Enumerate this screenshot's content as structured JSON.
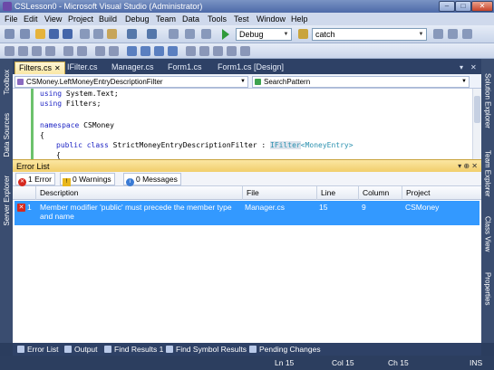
{
  "window": {
    "title": "CSLesson0 - Microsoft Visual Studio (Administrator)",
    "controls": {
      "minimize": "–",
      "maximize": "□",
      "close": "✕"
    }
  },
  "menu": [
    "File",
    "Edit",
    "View",
    "Project",
    "Build",
    "Debug",
    "Team",
    "Data",
    "Tools",
    "Test",
    "Window",
    "Help"
  ],
  "toolbar": {
    "configuration": "Debug",
    "find_value": "catch"
  },
  "left_tool_windows": [
    "Toolbox",
    "Data Sources",
    "Server Explorer"
  ],
  "right_tool_windows": [
    "Solution Explorer",
    "Team Explorer",
    "Class View",
    "Properties"
  ],
  "doc_tabs": [
    {
      "label": "Filters.cs",
      "active": true,
      "closable": true
    },
    {
      "label": "IFilter.cs",
      "active": false
    },
    {
      "label": "Manager.cs",
      "active": false
    },
    {
      "label": "Form1.cs",
      "active": false
    },
    {
      "label": "Form1.cs [Design]",
      "active": false
    }
  ],
  "navbar": {
    "type_combo": "CSMoney.LeftMoneyEntryDescriptionFilter",
    "member_combo": "SearchPattern"
  },
  "code": {
    "line1_kw": "using",
    "line1_rest": " System.Text;",
    "line2_kw": "using",
    "line2_rest": " Filters;",
    "line3_kw": "namespace",
    "line3_rest": " CSMoney",
    "line4": "{",
    "line5_kw1": "public",
    "line5_kw2": " class",
    "line5_name": " StrictMoneyEntryDescriptionFilter : ",
    "line5_iface": "IFilter",
    "line5_gen": "<MoneyEntry>",
    "line6": "{"
  },
  "error_list": {
    "title": "Error List",
    "header_tools": "▾ ⊕ ✕",
    "filters": {
      "errors": "1 Error",
      "warnings": "0 Warnings",
      "messages": "0 Messages"
    },
    "columns": [
      "Description",
      "File",
      "Line",
      "Column",
      "Project"
    ],
    "rows": [
      {
        "index": "1",
        "description": "Member modifier 'public' must precede the member type and name",
        "file": "Manager.cs",
        "line": "15",
        "column": "9",
        "project": "CSMoney"
      }
    ]
  },
  "bottom_tabs": [
    "Error List",
    "Output",
    "Find Results 1",
    "Find Symbol Results",
    "Pending Changes"
  ],
  "status": {
    "ln": "Ln 15",
    "col": "Col 15",
    "ch": "Ch 15",
    "mode": "INS"
  }
}
